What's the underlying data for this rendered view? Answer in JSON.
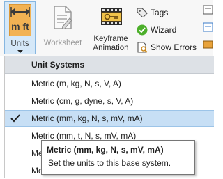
{
  "ribbon": {
    "units_label": "Units",
    "units_icon_text": "m ft",
    "worksheet_label": "Worksheet",
    "keyframe_label_line1": "Keyframe",
    "keyframe_label_line2": "Animation",
    "tags_label": "Tags",
    "wizard_label": "Wizard",
    "show_errors_label": "Show Errors"
  },
  "units_menu": {
    "header": "Unit Systems",
    "items": [
      {
        "label": "Metric (m, kg, N, s, V, A)",
        "checked": false
      },
      {
        "label": "Metric (cm, g, dyne, s, V, A)",
        "checked": false
      },
      {
        "label": "Metric (mm, kg, N, s, mV, mA)",
        "checked": true
      },
      {
        "label": "Metric (mm, t, N, s, mV, mA)",
        "checked": false
      },
      {
        "label": "Me",
        "checked": false
      },
      {
        "label": "Me",
        "checked": false
      }
    ]
  },
  "tooltip": {
    "title": "Metric (mm, kg, N, s, mV, mA)",
    "description": "Set the units to this base system."
  },
  "colors": {
    "selection": "#c7dff5",
    "header_bg": "#dde1e6",
    "units_button_bg": "#d5e8f8",
    "units_icon_orange": "#e8962b"
  }
}
